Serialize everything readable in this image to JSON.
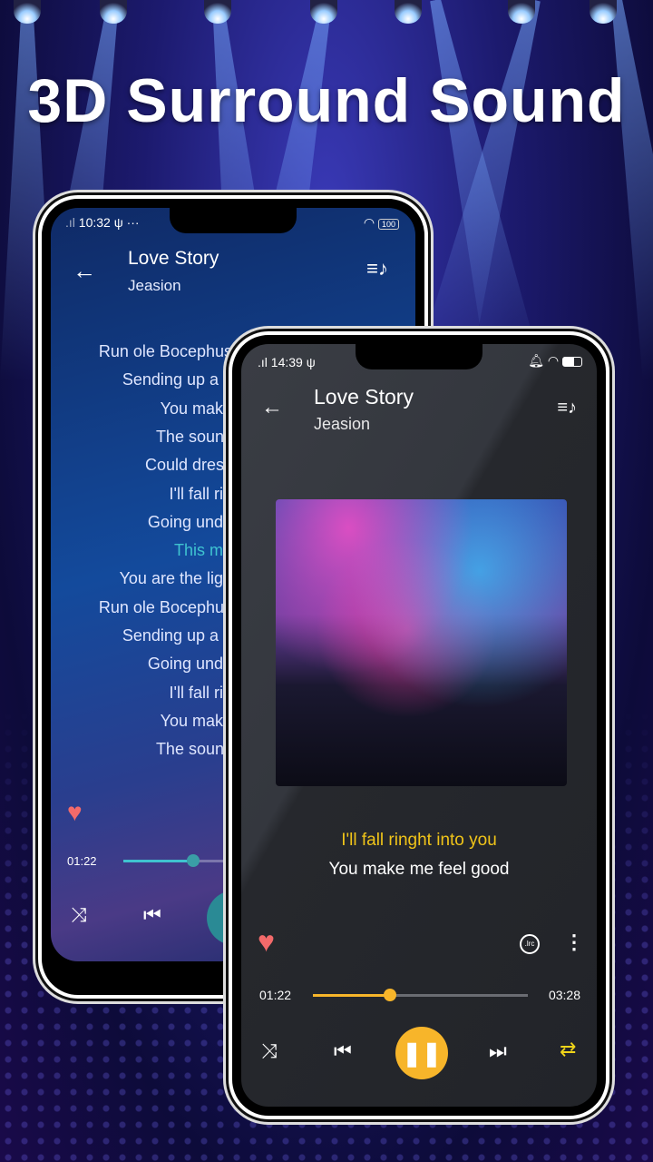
{
  "headline": "3D Surround Sound",
  "back_phone": {
    "status": {
      "time": "10:32",
      "battery": "100"
    },
    "header": {
      "title": "Love Story",
      "artist": "Jeasion"
    },
    "lyrics": [
      {
        "text": "Run ole Bocephus",
        "active": false
      },
      {
        "text": "Sending up a p",
        "active": false
      },
      {
        "text": "You make",
        "active": false
      },
      {
        "text": "The sounc",
        "active": false
      },
      {
        "text": "Could dress",
        "active": false
      },
      {
        "text": "I'll fall rin",
        "active": false
      },
      {
        "text": "Going unde",
        "active": false
      },
      {
        "text": "This mu",
        "active": true
      },
      {
        "text": "You are the ligh",
        "active": false
      },
      {
        "text": "Run ole Bocephus",
        "active": false
      },
      {
        "text": "Sending up a p",
        "active": false
      },
      {
        "text": "Going unde",
        "active": false
      },
      {
        "text": "I'll fall rin",
        "active": false
      },
      {
        "text": "You make",
        "active": false
      },
      {
        "text": "The sounc",
        "active": false
      }
    ],
    "elapsed": "01:22",
    "accent": "#3fc3d0"
  },
  "front_phone": {
    "status": {
      "time": "14:39"
    },
    "header": {
      "title": "Love Story",
      "artist": "Jeasion"
    },
    "lyrics": {
      "current": "I'll fall ringht into you",
      "next": "You make me feel good"
    },
    "elapsed": "01:22",
    "duration": "03:28",
    "progress": 0.36,
    "accent": "#f7b52a",
    "favorite": true,
    "repeat_mode": "repeat-all"
  }
}
